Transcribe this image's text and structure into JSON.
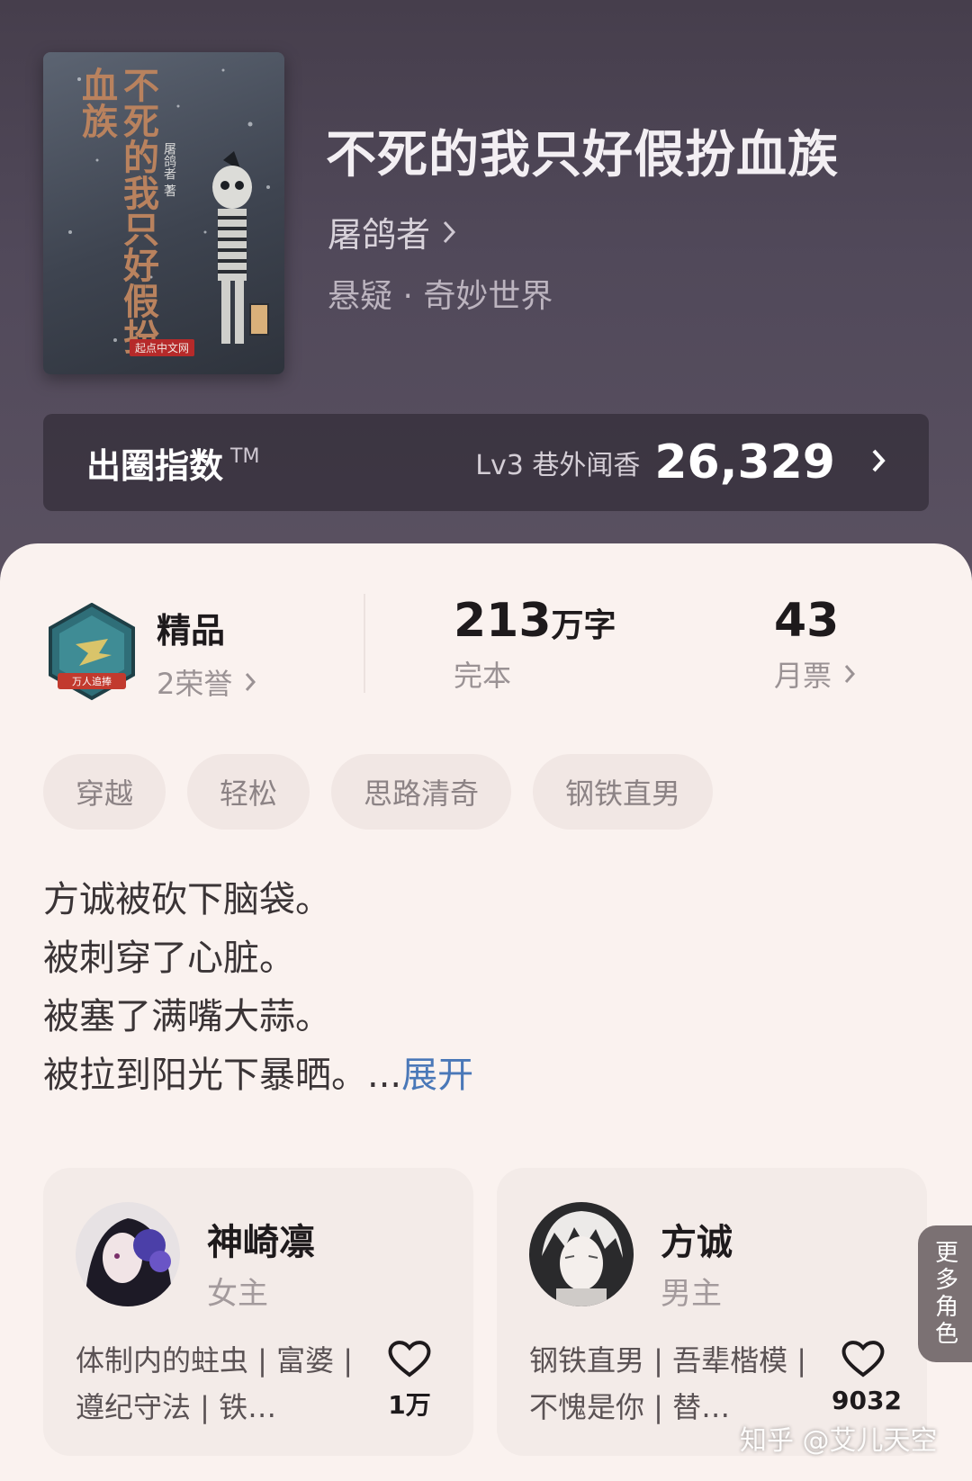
{
  "book": {
    "cover_title": "不死的我只好假扮血族",
    "cover_author": "屠鸽者 著",
    "cover_publisher": "起点中文网",
    "title": "不死的我只好假扮血族",
    "author": "屠鸽者",
    "genre": "悬疑 · 奇妙世界"
  },
  "index": {
    "label": "出圈指数",
    "tm": "TM",
    "level": "Lv3 巷外闻香",
    "score": "26,329"
  },
  "stats": {
    "badge_caption": "万人追捧",
    "quality": "精品",
    "honors": "2荣誉",
    "word_count_num": "213",
    "word_count_unit": "万字",
    "status": "完本",
    "monthly_votes": "43",
    "monthly_votes_label": "月票"
  },
  "tags": [
    "穿越",
    "轻松",
    "思路清奇",
    "钢铁直男"
  ],
  "synopsis": {
    "lines": [
      "方诚被砍下脑袋。",
      "被刺穿了心脏。",
      "被塞了满嘴大蒜。",
      "被拉到阳光下暴晒。..."
    ],
    "expand": "展开"
  },
  "characters": [
    {
      "name": "神崎凛",
      "role": "女主",
      "desc": "体制内的蛀虫 | 富婆 | 遵纪守法 | 铁…",
      "likes": "1万"
    },
    {
      "name": "方诚",
      "role": "男主",
      "desc": "钢铁直男 | 吾辈楷模 | 不愧是你 | 替…",
      "likes": "9032"
    }
  ],
  "more_roles": "更多角色",
  "watermark": "知乎 @艾儿天空",
  "colors": {
    "accent_blue": "#4a78b8",
    "hero_bg": "#4a4150",
    "card_bg": "#faf2ef"
  }
}
